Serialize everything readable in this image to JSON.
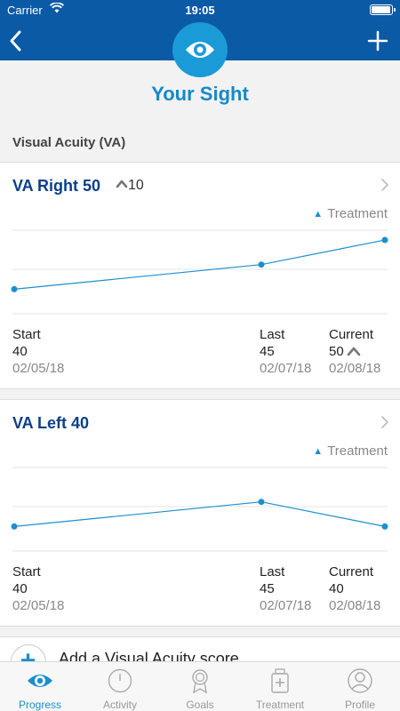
{
  "status_bar": {
    "carrier": "Carrier",
    "time": "19:05"
  },
  "header": {
    "title": "Your Sight"
  },
  "section": {
    "label": "Visual Acuity (VA)"
  },
  "cards": [
    {
      "title": "VA Right 50",
      "change": "10",
      "legend": "Treatment",
      "chart_data": {
        "type": "line",
        "x": [
          "02/05/18",
          "02/07/18",
          "02/08/18"
        ],
        "values": [
          40,
          45,
          50
        ],
        "series_name": "Treatment"
      },
      "start": {
        "label": "Start",
        "value": "40",
        "date": "02/05/18"
      },
      "last": {
        "label": "Last",
        "value": "45",
        "date": "02/07/18"
      },
      "current": {
        "label": "Current",
        "value": "50",
        "date": "02/08/18",
        "trend": "up"
      }
    },
    {
      "title": "VA Left 40",
      "legend": "Treatment",
      "chart_data": {
        "type": "line",
        "x": [
          "02/05/18",
          "02/07/18",
          "02/08/18"
        ],
        "values": [
          40,
          45,
          40
        ],
        "series_name": "Treatment"
      },
      "start": {
        "label": "Start",
        "value": "40",
        "date": "02/05/18"
      },
      "last": {
        "label": "Last",
        "value": "45",
        "date": "02/07/18"
      },
      "current": {
        "label": "Current",
        "value": "40",
        "date": "02/08/18"
      }
    }
  ],
  "add_action": {
    "label": "Add a Visual Acuity score"
  },
  "tabs": [
    {
      "label": "Progress",
      "icon": "eye-icon",
      "active": true
    },
    {
      "label": "Activity",
      "icon": "clock-icon",
      "active": false
    },
    {
      "label": "Goals",
      "icon": "award-icon",
      "active": false
    },
    {
      "label": "Treatment",
      "icon": "medicine-icon",
      "active": false
    },
    {
      "label": "Profile",
      "icon": "person-icon",
      "active": false
    }
  ],
  "colors": {
    "nav": "#0a5aa6",
    "accent": "#1a9ad6",
    "title_text": "#0b3f8a",
    "series_line": "#1a90cf"
  }
}
